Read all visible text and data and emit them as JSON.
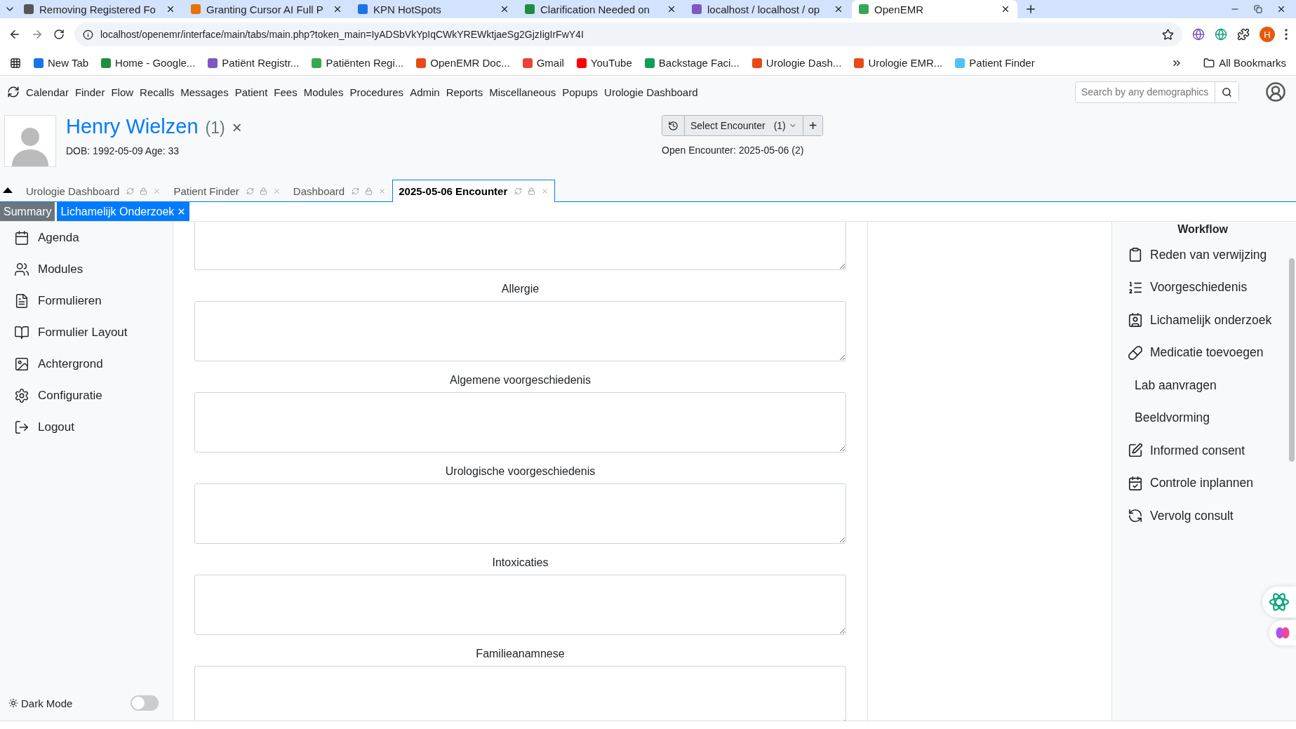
{
  "browser": {
    "tabs": [
      {
        "title": "Removing Registered Fo",
        "selected": false
      },
      {
        "title": "Granting Cursor AI Full P",
        "selected": false
      },
      {
        "title": "KPN HotSpots",
        "selected": false
      },
      {
        "title": "Clarification Needed on",
        "selected": false
      },
      {
        "title": "localhost / localhost / op",
        "selected": false
      },
      {
        "title": "OpenEMR",
        "selected": true
      }
    ],
    "address": "localhost/openemr/interface/main/tabs/main.php?token_main=IyADSbVkYpIqCWkYREWktjaeSg2GjzIigIrFwY4I",
    "bookmarks": [
      "New Tab",
      "Home - Google...",
      "Patiënt Registr...",
      "Patiënten Regi...",
      "OpenEMR Doc...",
      "Gmail",
      "YouTube",
      "Backstage Faci...",
      "Urologie Dash...",
      "Urologie EMR...",
      "Patient Finder"
    ],
    "all_bookmarks": "All Bookmarks",
    "profile_initial": "H"
  },
  "menu": [
    "Calendar",
    "Finder",
    "Flow",
    "Recalls",
    "Messages",
    "Patient",
    "Fees",
    "Modules",
    "Procedures",
    "Admin",
    "Reports",
    "Miscellaneous",
    "Popups",
    "Urologie Dashboard"
  ],
  "search": {
    "placeholder": "Search by any demographics"
  },
  "patient": {
    "name": "Henry Wielzen",
    "pid": "(1)",
    "dob": "DOB: 1992-05-09 Age: 33",
    "close": "×"
  },
  "encounter": {
    "select": "Select Encounter",
    "count": "(1)",
    "add": "+",
    "open": "Open Encounter: 2025-05-06 (2)"
  },
  "tabs": [
    {
      "label": "Urologie Dashboard",
      "selected": false
    },
    {
      "label": "Patient Finder",
      "selected": false
    },
    {
      "label": "Dashboard",
      "selected": false
    },
    {
      "label": "2025-05-06 Encounter",
      "selected": true
    }
  ],
  "subtabs": [
    {
      "label": "Summary",
      "selected": false,
      "closable": false
    },
    {
      "label": "Lichamelijk Onderzoek",
      "selected": true,
      "closable": true
    }
  ],
  "sidebar": {
    "items": [
      "Agenda",
      "Modules",
      "Formulieren",
      "Formulier Layout",
      "Achtergrond",
      "Configuratie",
      "Logout"
    ],
    "dark_mode": {
      "label": "Dark Mode",
      "on": false
    }
  },
  "form": {
    "fields": [
      {
        "cut": true
      },
      {
        "label": "Allergie"
      },
      {
        "label": "Algemene voorgeschiedenis"
      },
      {
        "label": "Urologische voorgeschiedenis"
      },
      {
        "label": "Intoxicaties"
      },
      {
        "label": "Familieanamnese"
      }
    ]
  },
  "workflow": {
    "title": "Workflow",
    "items": [
      {
        "label": "Reden van verwijzing",
        "kind": "icon"
      },
      {
        "label": "Voorgeschiedenis",
        "kind": "icon"
      },
      {
        "label": "Lichamelijk onderzoek",
        "kind": "icon"
      },
      {
        "label": "Medicatie toevoegen",
        "kind": "icon"
      },
      {
        "label": "Lab aanvragen",
        "kind": "plain"
      },
      {
        "label": "Beeldvorming",
        "kind": "plain"
      },
      {
        "label": "Informed consent",
        "kind": "icon"
      },
      {
        "label": "Controle inplannen",
        "kind": "icon"
      },
      {
        "label": "Vervolg consult",
        "kind": "icon"
      }
    ]
  }
}
